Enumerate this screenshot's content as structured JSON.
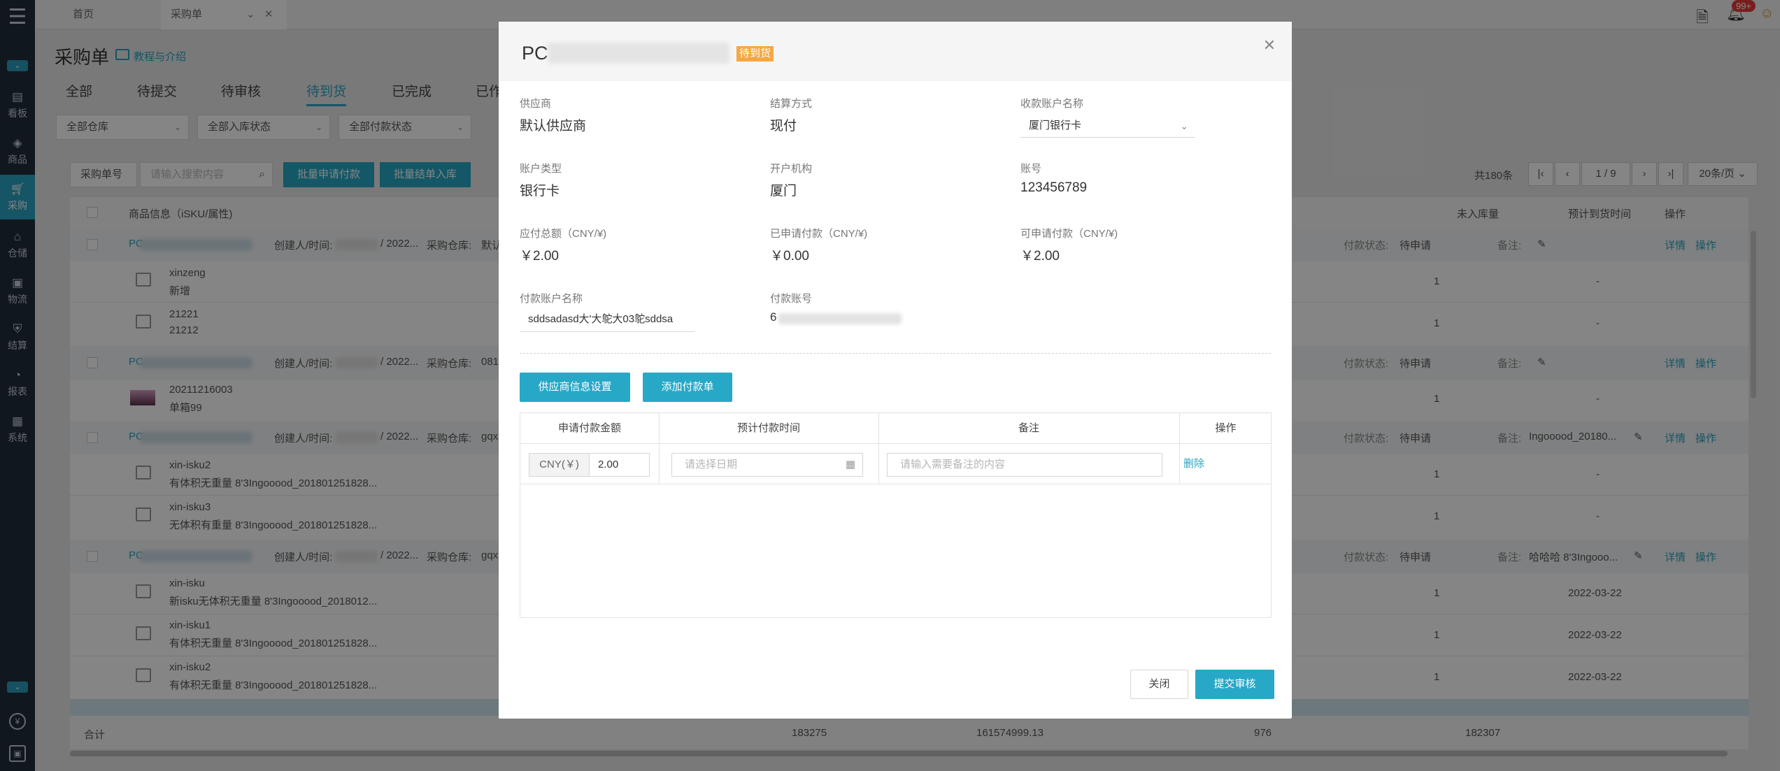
{
  "sidebar": {
    "items": [
      {
        "label": "看板",
        "icon": "dashboard-icon"
      },
      {
        "label": "商品",
        "icon": "box-icon"
      },
      {
        "label": "采购",
        "icon": "cart-icon"
      },
      {
        "label": "仓储",
        "icon": "warehouse-icon"
      },
      {
        "label": "物流",
        "icon": "truck-icon"
      },
      {
        "label": "结算",
        "icon": "shield-icon"
      },
      {
        "label": "报表",
        "icon": "pie-chart-icon"
      },
      {
        "label": "系统",
        "icon": "grid-icon"
      }
    ],
    "active": "采购"
  },
  "topbar": {
    "tabs": [
      {
        "label": "首页"
      },
      {
        "label": "采购单"
      }
    ],
    "notification_count": "99+"
  },
  "page": {
    "title": "采购单",
    "help_link": "教程与介绍",
    "tabs": [
      "全部",
      "待提交",
      "待审核",
      "待到货",
      "已完成",
      "已作"
    ],
    "active_tab": "待到货",
    "filters": [
      "全部仓库",
      "全部入库状态",
      "全部付款状态"
    ],
    "search_type": "采购单号",
    "search_placeholder": "请输入搜索内容",
    "batch_pay_label": "批量申请付款",
    "batch_stockin_label": "批量结单入库",
    "total_label": "共180条",
    "page_current": "1",
    "page_total": "/ 9",
    "page_size": "20条/页",
    "col_product": "商品信息（iSKU/属性)",
    "col_not_stocked": "未入库量",
    "col_eta": "预计到货时间",
    "col_actions": "操作",
    "group_rows": [
      {
        "prefix": "PC",
        "creator": "创建人/时间:",
        "date": "/ 2022...",
        "warehouse": "采购仓库:",
        "warehouse_val": "默认",
        "pay_status_label": "付款状态:",
        "pay_status": "待申请",
        "note_label": "备注:",
        "note": "",
        "detail": "详情",
        "op": "操作"
      },
      {
        "prefix": "PC",
        "creator": "创建人/时间:",
        "date": "/ 2022...",
        "warehouse": "采购仓库:",
        "warehouse_val": "081",
        "pay_status_label": "付款状态:",
        "pay_status": "待申请",
        "note_label": "备注:",
        "note": "",
        "detail": "详情",
        "op": "操作"
      },
      {
        "prefix": "PC",
        "creator": "创建人/时间:",
        "date": "/ 2022...",
        "warehouse": "采购仓库:",
        "warehouse_val": "gqx",
        "pay_status_label": "付款状态:",
        "pay_status": "待申请",
        "note_label": "备注:",
        "note": "Ingooood_20180...",
        "detail": "详情",
        "op": "操作"
      },
      {
        "prefix": "PC",
        "creator": "创建人/时间:",
        "date": "/ 2022...",
        "warehouse": "采购仓库:",
        "warehouse_val": "gqx",
        "pay_status_label": "付款状态:",
        "pay_status": "待申请",
        "note_label": "备注:",
        "note": "哈哈哈 8'3Ingooo...",
        "detail": "详情",
        "op": "操作"
      }
    ],
    "item_rows": [
      {
        "name": "xinzeng",
        "attr": "新增",
        "qty": "1",
        "eta": "-"
      },
      {
        "name": "21221",
        "attr": "21212",
        "qty": "1",
        "eta": "-"
      },
      {
        "name": "20211216003",
        "attr": "单箱99",
        "qty": "1",
        "eta": "-"
      },
      {
        "name": "xin-isku2",
        "attr": "有体积无重量 8'3Ingooood_201801251828...",
        "qty": "1",
        "eta": "-"
      },
      {
        "name": "xin-isku3",
        "attr": "无体积有重量 8'3Ingooood_201801251828...",
        "qty": "1",
        "eta": "-"
      },
      {
        "name": "xin-isku",
        "attr": "新isku无体积无重量 8'3Ingooood_2018012...",
        "qty": "1",
        "eta": "2022-03-22"
      },
      {
        "name": "xin-isku1",
        "attr": "有体积无重量 8'3Ingooood_201801251828...",
        "qty": "1",
        "eta": "2022-03-22"
      },
      {
        "name": "xin-isku2",
        "attr": "有体积无重量 8'3Ingooood_201801251828...",
        "qty": "1",
        "eta": "2022-03-22"
      }
    ],
    "footer": {
      "label": "合计",
      "v1": "183275",
      "v2": "161574999.13",
      "v3": "976",
      "v4": "182307"
    }
  },
  "modal": {
    "title_prefix": "PC",
    "status": "待到货",
    "fields": {
      "supplier_label": "供应商",
      "supplier": "默认供应商",
      "settlement_label": "结算方式",
      "settlement": "现付",
      "receiver_account_label": "收款账户名称",
      "receiver_account": "厦门银行卡",
      "account_type_label": "账户类型",
      "account_type": "银行卡",
      "bank_label": "开户机构",
      "bank": "厦门",
      "account_no_label": "账号",
      "account_no": "123456789",
      "payable_label": "应付总额（CNY/¥)",
      "payable": "￥2.00",
      "applied_label": "已申请付款（CNY/¥)",
      "applied": "￥0.00",
      "available_label": "可申请付款（CNY/¥)",
      "available": "￥2.00",
      "pay_account_label": "付款账户名称",
      "pay_account": "sddsadasd大'大鸵大03鸵sddsa",
      "pay_account_no_label": "付款账号",
      "pay_account_no_prefix": "6"
    },
    "supplier_settings_label": "供应商信息设置",
    "add_payment_label": "添加付款单",
    "table": {
      "headers": [
        "申请付款金额",
        "预计付款时间",
        "备注",
        "操作"
      ],
      "rows": [
        {
          "currency": "CNY(￥)",
          "amount": "2.00",
          "date_placeholder": "请选择日期",
          "note_placeholder": "请输入需要备注的内容",
          "delete": "删除"
        }
      ]
    },
    "close_label": "关闭",
    "submit_label": "提交审核"
  },
  "colors": {
    "accent": "#27a8c6",
    "status_orange": "#f5a743",
    "sidebar_bg": "#1f2d3a"
  }
}
